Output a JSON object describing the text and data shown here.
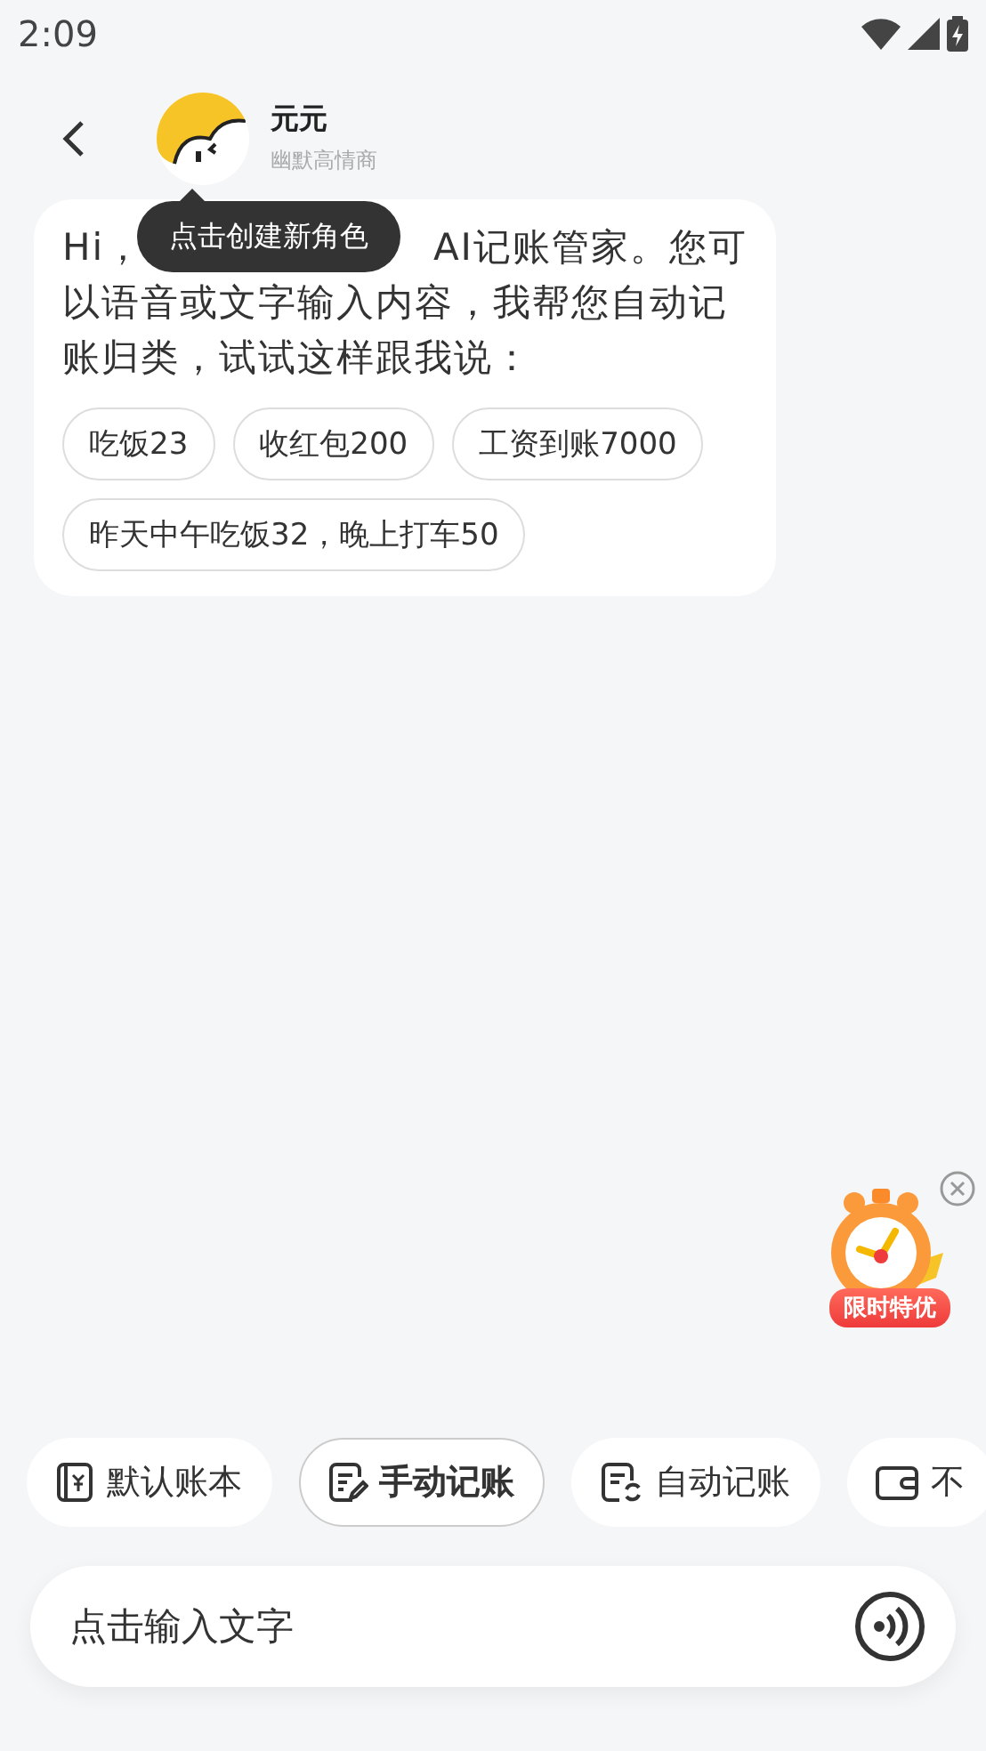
{
  "status_bar": {
    "time": "2:09"
  },
  "header": {
    "name": "元元",
    "subtitle": "幽默高情商"
  },
  "tooltip": {
    "text": "点击创建新角色"
  },
  "message": {
    "greeting": "Hi，",
    "body_first_line": "AI记账管家。您可",
    "body": "以语音或文字输入内容，我帮您自动记账归类，试试这样跟我说：",
    "suggestions": [
      "吃饭23",
      "收红包200",
      "工资到账7000",
      "昨天中午吃饭32，晚上打车50"
    ]
  },
  "promo": {
    "label": "限时特优"
  },
  "chips": [
    {
      "kind": "book",
      "label": "默认账本",
      "selected": false
    },
    {
      "kind": "manual",
      "label": "手动记账",
      "selected": true
    },
    {
      "kind": "auto",
      "label": "自动记账",
      "selected": false
    },
    {
      "kind": "wallet",
      "label": "不",
      "selected": false
    }
  ],
  "input": {
    "placeholder": "点击输入文字"
  }
}
